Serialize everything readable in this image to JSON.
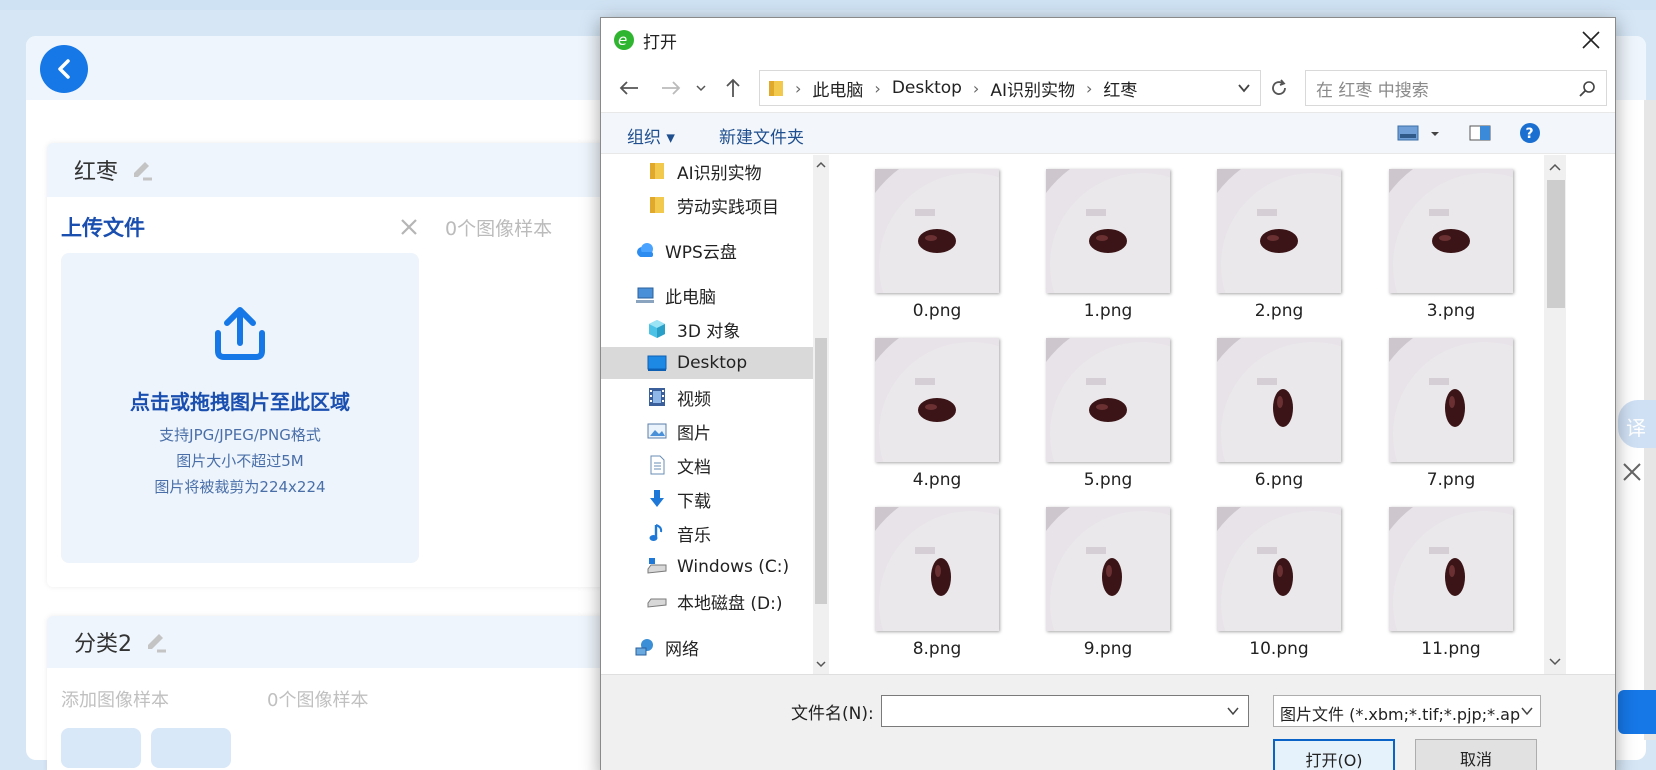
{
  "app": {
    "category1": {
      "title": "红枣",
      "upload_title": "上传文件",
      "sample_count": "0个图像样本",
      "dropzone": {
        "main": "点击或拖拽图片至此区域",
        "hint1": "支持JPG/JPEG/PNG格式",
        "hint2": "图片大小不超过5M",
        "hint3": "图片将被裁剪为224x224"
      }
    },
    "category2": {
      "title": "分类2",
      "add_sample": "添加图像样本",
      "sample_count": "0个图像样本"
    },
    "side_tab": "译"
  },
  "dialog": {
    "title": "打开",
    "breadcrumb": [
      "此电脑",
      "Desktop",
      "AI识别实物",
      "红枣"
    ],
    "search_placeholder": "在 红枣 中搜索",
    "toolbar": {
      "organize": "组织 ▾",
      "new_folder": "新建文件夹"
    },
    "nav_items": [
      {
        "label": "AI识别实物",
        "icon": "folder-icon"
      },
      {
        "label": "劳动实践项目",
        "icon": "folder-icon"
      },
      {
        "label": "WPS云盘",
        "icon": "cloud-icon"
      },
      {
        "label": "此电脑",
        "icon": "computer-icon"
      },
      {
        "label": "3D 对象",
        "icon": "cube-icon"
      },
      {
        "label": "Desktop",
        "icon": "desktop-icon"
      },
      {
        "label": "视频",
        "icon": "video-icon"
      },
      {
        "label": "图片",
        "icon": "picture-icon"
      },
      {
        "label": "文档",
        "icon": "document-icon"
      },
      {
        "label": "下载",
        "icon": "download-icon"
      },
      {
        "label": "音乐",
        "icon": "music-icon"
      },
      {
        "label": "Windows (C:)",
        "icon": "drive-icon"
      },
      {
        "label": "本地磁盘 (D:)",
        "icon": "drive-icon"
      },
      {
        "label": "网络",
        "icon": "network-icon"
      }
    ],
    "files": [
      "0.png",
      "1.png",
      "2.png",
      "3.png",
      "4.png",
      "5.png",
      "6.png",
      "7.png",
      "8.png",
      "9.png",
      "10.png",
      "11.png"
    ],
    "filename_label": "文件名(N):",
    "filename_value": "",
    "filetype": "图片文件 (*.xbm;*.tif;*.pjp;*.ap",
    "open_button": "打开(O)",
    "cancel_button": "取消"
  },
  "colors": {
    "accent": "#1677e6",
    "primary_text": "#1a4fb0",
    "dropzone_bg": "#edf4fc"
  }
}
